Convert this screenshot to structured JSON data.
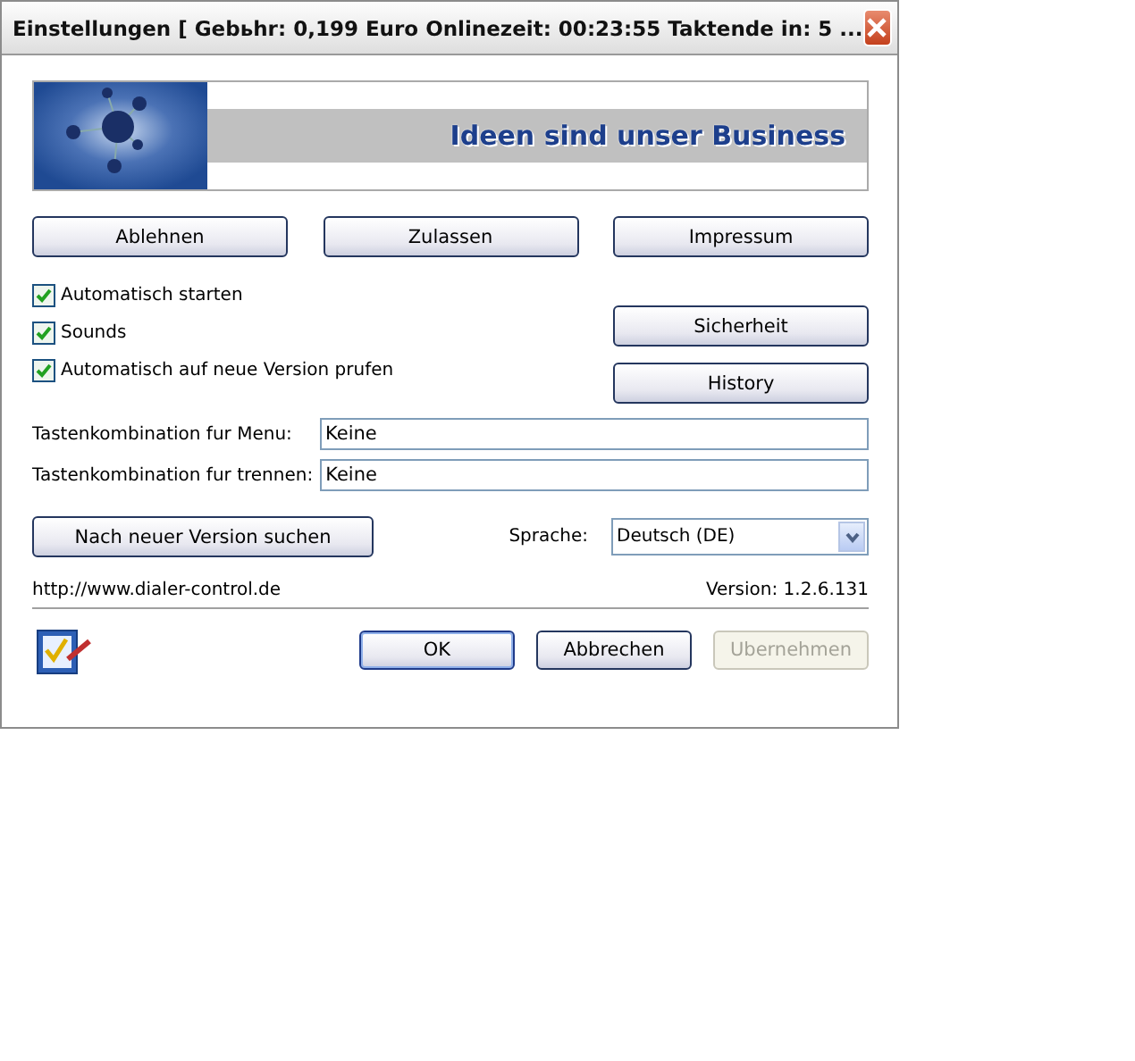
{
  "window": {
    "title": "Einstellungen [ Gebьhr: 0,199 Euro Onlinezeit: 00:23:55 Taktende in: 5 ..."
  },
  "banner": {
    "slogan": "Ideen sind unser Business"
  },
  "top_buttons": [
    "Ablehnen",
    "Zulassen",
    "Impressum"
  ],
  "checkboxes": [
    {
      "label": "Automatisch starten",
      "checked": true
    },
    {
      "label": "Sounds",
      "checked": true
    },
    {
      "label": "Automatisch auf neue Version prufen",
      "checked": true
    }
  ],
  "side_buttons": [
    "Sicherheit",
    "History"
  ],
  "fields": [
    {
      "label": "Tastenkombination fur Menu:",
      "value": "Keine"
    },
    {
      "label": "Tastenkombination fur trennen:",
      "value": "Keine"
    }
  ],
  "update_button": "Nach neuer Version suchen",
  "language": {
    "label": "Sprache:",
    "value": "Deutsch (DE)"
  },
  "url": "http://www.dialer-control.de",
  "version": "Version: 1.2.6.131",
  "buttons": [
    {
      "label": "OK",
      "disabled": false,
      "default": true
    },
    {
      "label": "Abbrechen",
      "disabled": false,
      "default": false
    },
    {
      "label": "Ubernehmen",
      "disabled": true,
      "default": false
    }
  ]
}
